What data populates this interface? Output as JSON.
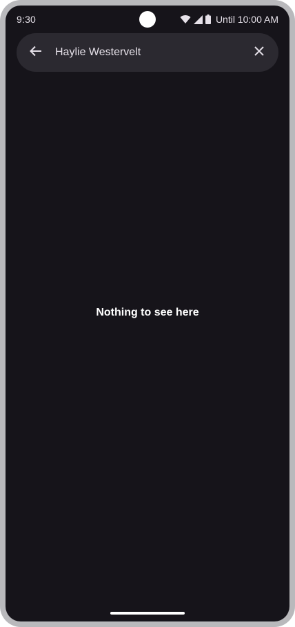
{
  "status_bar": {
    "time": "9:30",
    "battery_text": "Until 10:00 AM",
    "icons": [
      "wifi-icon",
      "signal-icon",
      "battery-icon"
    ]
  },
  "search": {
    "value": "Haylie Westervelt",
    "back_icon": "arrow-back-icon",
    "clear_icon": "close-icon"
  },
  "main": {
    "empty_message": "Nothing to see here"
  },
  "colors": {
    "background": "#16141a",
    "search_bar": "#2b2930",
    "text": "#e6e1e9"
  }
}
